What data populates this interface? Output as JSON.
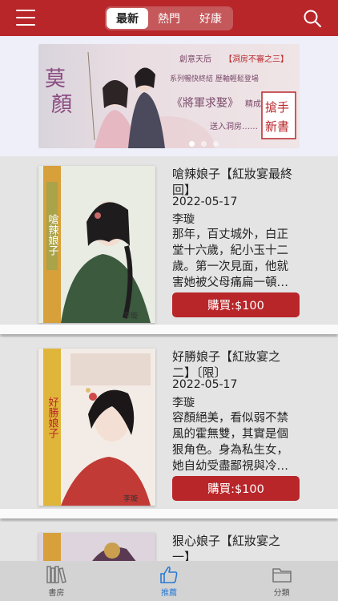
{
  "header": {
    "tabs": [
      {
        "label": "最新",
        "active": true
      },
      {
        "label": "熱門",
        "active": false
      },
      {
        "label": "好康",
        "active": false
      }
    ],
    "menu_icon": "hamburger-menu-icon",
    "search_icon": "search-icon"
  },
  "banner": {
    "logo_text": "莫顏",
    "line1": "創意天后",
    "line1_tag": "洞房不審之三",
    "line2": "系列暢快終結 歷軸輕鬆登場",
    "book_title": "《將軍求娶》",
    "line3": "精成！",
    "line4": "送入洞房……",
    "stamp": "搶手新書",
    "slide_count": 3,
    "active_slide": 1
  },
  "books": [
    {
      "title": "嗆辣娘子【紅妝宴最終回】",
      "date": "2022-05-17",
      "author": "李璇",
      "description": "那年，百丈城外，白正堂十六歲，紀小玉十二歲。第一次見面，他就害她被父母痛扁一頓…",
      "buy_label": "購買:$100",
      "cover_title": "嗆辣娘子",
      "cover_author": "李璇"
    },
    {
      "title": "好勝娘子【紅妝宴之二】〔限〕",
      "date": "2022-05-17",
      "author": "李璇",
      "description": "容顏絕美，看似弱不禁風的霍無雙，其實是個狠角色。身為私生女，她自幼受盡鄙視與冷…",
      "buy_label": "購買:$100",
      "cover_title": "好勝娘子",
      "cover_author": "李璇"
    },
    {
      "title": "狠心娘子【紅妝宴之一】",
      "date": "",
      "author": "",
      "description": "",
      "buy_label": "",
      "cover_title": "",
      "cover_author": ""
    }
  ],
  "bottom_nav": [
    {
      "label": "書房",
      "icon": "bookshelf-icon",
      "active": false
    },
    {
      "label": "推薦",
      "icon": "thumbs-up-icon",
      "active": true
    },
    {
      "label": "分類",
      "icon": "folder-icon",
      "active": false
    }
  ],
  "colors": {
    "brand": "#b8262a",
    "active_nav": "#2a7bd4"
  }
}
